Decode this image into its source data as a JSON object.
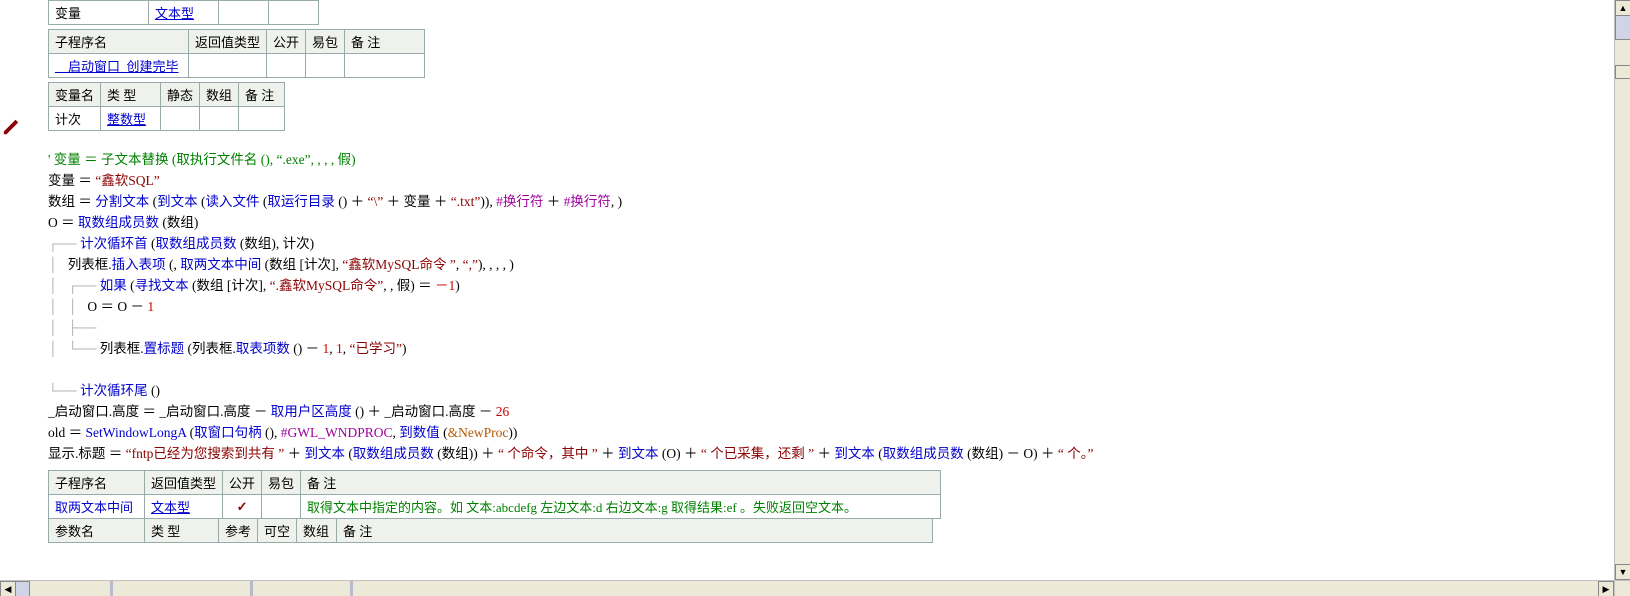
{
  "table_var": {
    "r0_c0": "变量",
    "r0_c1": "文本型"
  },
  "table_sub": {
    "headers": [
      "子程序名",
      "返回值类型",
      "公开",
      "易包",
      "备 注"
    ],
    "r0_c0": "__启动窗口_创建完毕"
  },
  "table_local": {
    "headers": [
      "变量名",
      "类 型",
      "静态",
      "数组",
      "备 注"
    ],
    "r0_c0": "计次",
    "r0_c1": "整数型"
  },
  "code": {
    "l1a": "' 变量 ＝ 子文本替换 (取执行文件名 (), ",
    "l1b": "“.exe”",
    "l1c": ", , , , 假)",
    "l2a": "变量 ＝ ",
    "l2b": "“鑫软SQL”",
    "l3a": "数组 ＝ ",
    "l3b": "分割文本",
    "l3c": " (",
    "l3d": "到文本",
    "l3e": " (",
    "l3f": "读入文件",
    "l3g": " (",
    "l3h": "取运行目录",
    "l3i": " () ＋ ",
    "l3j": "“\\”",
    "l3k": " ＋ 变量 ＋ ",
    "l3l": "“.txt”",
    "l3m": ")), ",
    "l3n": "#换行符",
    "l3o": " ＋ ",
    "l3p": "#换行符",
    "l3q": ", )",
    "l4a": "O ＝ ",
    "l4b": "取数组成员数",
    "l4c": " (数组)",
    "l5pre": "┌── ",
    "l5a": "计次循环首",
    "l5b": " (",
    "l5c": "取数组成员数",
    "l5d": " (数组), 计次)",
    "l6pre": "│   ",
    "l6a": "列表框.",
    "l6b": "插入表项",
    "l6c": " (, ",
    "l6d": "取两文本中间",
    "l6e": " (数组 [计次], ",
    "l6f": "“鑫软MySQL命令 ”",
    "l6g": ", ",
    "l6h": "“,”",
    "l6i": "), , , , )",
    "l7pre": "│   ┌── ",
    "l7a": "如果",
    "l7b": " (",
    "l7c": "寻找文本",
    "l7d": " (数组 [计次], ",
    "l7e": "“.鑫软MySQL命令”",
    "l7f": ", , 假) ＝ ",
    "l7g": "－1",
    "l7h": ")",
    "l8pre": "│   │   ",
    "l8a": "O ＝ O － ",
    "l8b": "1",
    "l9pre": "│   ├── ",
    "l10pre": "│   └── ",
    "l10a": "列表框.",
    "l10b": "置标题",
    "l10c": " (列表框.",
    "l10d": "取表项数",
    "l10e": " () － ",
    "l10f": "1",
    "l10g": ", ",
    "l10h": "1",
    "l10i": ", ",
    "l10j": "“已学习”",
    "l10k": ")",
    "l12pre": "└── ",
    "l12a": "计次循环尾",
    "l12b": " ()",
    "l13a": "_启动窗口.高度 ＝ _启动窗口.高度 － ",
    "l13b": "取用户区高度",
    "l13c": " () ＋ _启动窗口.高度 － ",
    "l13d": "26",
    "l14a": "old ＝ ",
    "l14b": "SetWindowLongA",
    "l14c": " (",
    "l14d": "取窗口句柄",
    "l14e": " (), ",
    "l14f": "#GWL_WNDPROC",
    "l14g": ", ",
    "l14h": "到数值",
    "l14i": " (",
    "l14j": "&NewProc",
    "l14k": "))",
    "l15a": "显示.标题 ＝ ",
    "l15b": "“fntp已经为您搜索到共有 ”",
    "l15c": " ＋ ",
    "l15d": "到文本",
    "l15e": " (",
    "l15f": "取数组成员数",
    "l15g": " (数组)) ＋ ",
    "l15h": "“ 个命令，其中 ”",
    "l15i": " ＋ ",
    "l15j": "到文本",
    "l15k": " (O) ＋ ",
    "l15l": "“ 个已采集，还剩 ”",
    "l15m": " ＋ ",
    "l15n": "到文本",
    "l15o": " (",
    "l15p": "取数组成员数",
    "l15q": " (数组) － O) ＋ ",
    "l15r": "“ 个。”"
  },
  "table_sub2": {
    "headers": [
      "子程序名",
      "返回值类型",
      "公开",
      "易包",
      "备 注"
    ],
    "r0_c0": "取两文本中间",
    "r0_c1": "文本型",
    "r0_c2": "✓",
    "r0_c4": "取得文本中指定的内容。如 文本:abcdefg 左边文本:d 右边文本:g 取得结果:ef 。失败返回空文本。"
  },
  "table_params": {
    "headers": [
      "参数名",
      "类 型",
      "参考",
      "可空",
      "数组",
      "备 注"
    ]
  },
  "hscroll_ticks": [
    110,
    250,
    350
  ]
}
